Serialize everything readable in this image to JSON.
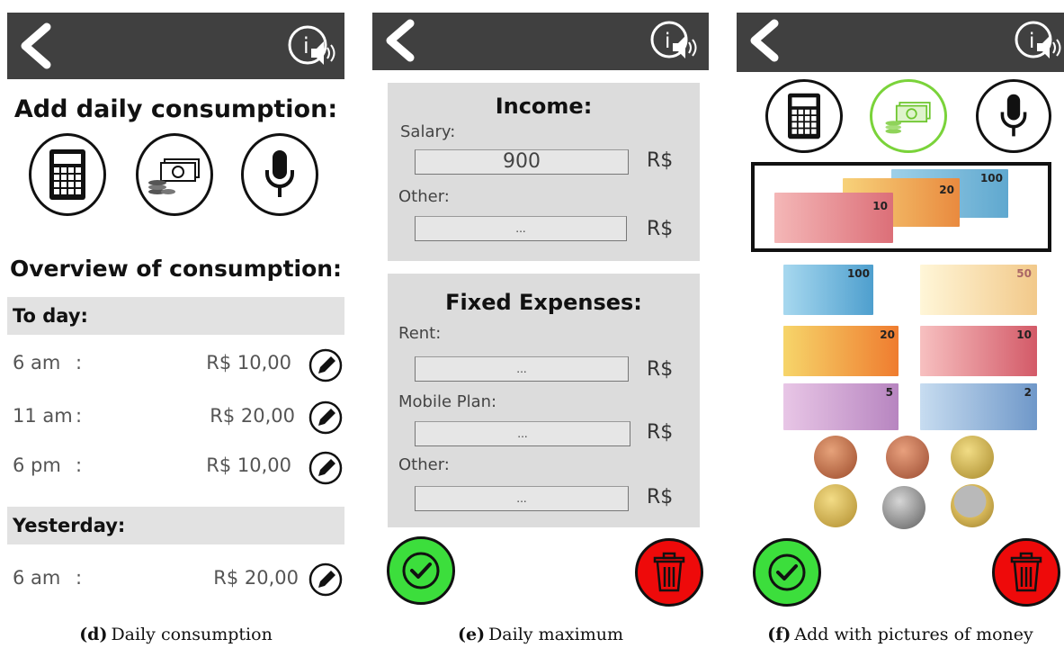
{
  "screen_d": {
    "title": "Add daily consumption:",
    "overview_title": "Overview of  consumption:",
    "today_label": "To day:",
    "today_rows": [
      {
        "time": "6 am",
        "sep": ":",
        "value": "R$ 10,00"
      },
      {
        "time": "11 am",
        "sep": ":",
        "value": "R$ 20,00"
      },
      {
        "time": "6 pm",
        "sep": ":",
        "value": "R$ 10,00"
      }
    ],
    "yesterday_label": "Yesterday:",
    "yesterday_rows": [
      {
        "time": "6 am",
        "sep": ":",
        "value": "R$ 20,00"
      }
    ],
    "caption_tag": "(d)",
    "caption": "Daily consumption"
  },
  "screen_e": {
    "income_title": "Income:",
    "salary_label": "Salary:",
    "salary_value": "900",
    "other_label": "Other:",
    "other_value": "...",
    "fixed_title": "Fixed Expenses:",
    "rent_label": "Rent:",
    "rent_value": "...",
    "mobile_label": "Mobile Plan:",
    "mobile_value": "...",
    "other2_label": "Other:",
    "other2_value": "...",
    "currency": "R$",
    "caption_tag": "(e)",
    "caption": "Daily maximum"
  },
  "screen_f": {
    "notes": [
      "100",
      "50",
      "20",
      "10",
      "5",
      "2"
    ],
    "hero_notes": [
      "100",
      "20",
      "10"
    ],
    "caption_tag": "(f)",
    "caption": "Add with pictures of money"
  },
  "colors": {
    "topbar": "#404040",
    "section": "#e2e2e2",
    "panel": "#dcdcdc",
    "confirm": "#3cde3c",
    "delete": "#ee0a0a",
    "selected_ring": "#7ad33a"
  },
  "icons": [
    "back-arrow-icon",
    "info-audio-icon",
    "calculator-icon",
    "money-icon",
    "microphone-icon",
    "pencil-icon",
    "checkmark-icon",
    "trash-icon"
  ]
}
